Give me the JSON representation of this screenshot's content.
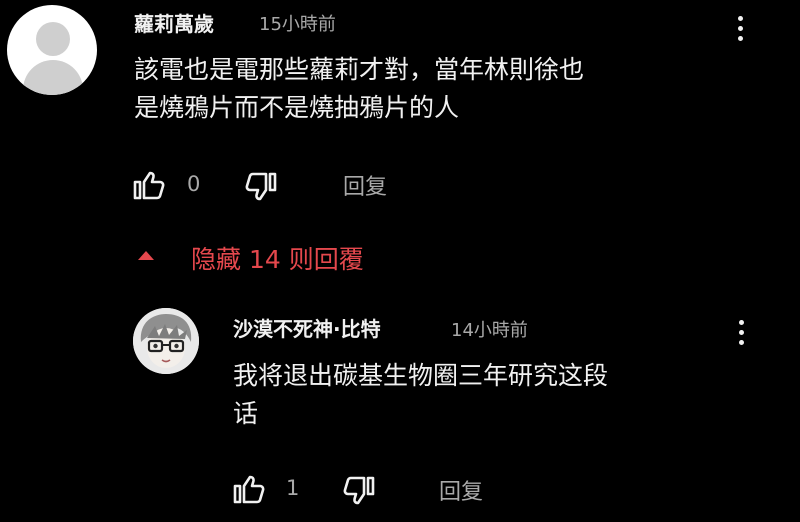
{
  "comment": {
    "author": "蘿莉萬歲",
    "timestamp": "15小時前",
    "text_lines": [
      "該電也是電那些蘿莉才對，當年林則徐也",
      "是燒鴉片而不是燒抽鴉片的人"
    ],
    "likes": "0",
    "reply_label": "回复",
    "avatar_icon": "default-user-avatar-icon",
    "menu_icon": "more-vert-icon"
  },
  "replies_toggle": {
    "label": "隐藏 14 则回覆",
    "icon": "caret-up-icon",
    "color": "#e5484d"
  },
  "reply": {
    "author": "沙漠不死神·比特",
    "timestamp": "14小時前",
    "text_lines": [
      "我将退出碳基生物圈三年研究这段",
      "话"
    ],
    "likes": "1",
    "reply_label": "回复",
    "avatar_icon": "anime-avatar-icon",
    "menu_icon": "more-vert-icon"
  }
}
